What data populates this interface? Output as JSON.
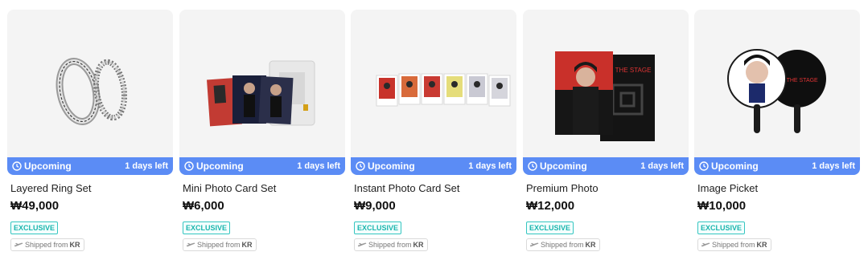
{
  "products": [
    {
      "status": "Upcoming",
      "days_left": "1 days left",
      "name": "Layered Ring Set",
      "price": "₩49,000",
      "badge": "EXCLUSIVE",
      "ship_prefix": "Shipped from",
      "ship_country": "KR"
    },
    {
      "status": "Upcoming",
      "days_left": "1 days left",
      "name": "Mini Photo Card Set",
      "price": "₩6,000",
      "badge": "EXCLUSIVE",
      "ship_prefix": "Shipped from",
      "ship_country": "KR"
    },
    {
      "status": "Upcoming",
      "days_left": "1 days left",
      "name": "Instant Photo Card Set",
      "price": "₩9,000",
      "badge": "EXCLUSIVE",
      "ship_prefix": "Shipped from",
      "ship_country": "KR"
    },
    {
      "status": "Upcoming",
      "days_left": "1 days left",
      "name": "Premium Photo",
      "price": "₩12,000",
      "badge": "EXCLUSIVE",
      "ship_prefix": "Shipped from",
      "ship_country": "KR"
    },
    {
      "status": "Upcoming",
      "days_left": "1 days left",
      "name": "Image Picket",
      "price": "₩10,000",
      "badge": "EXCLUSIVE",
      "ship_prefix": "Shipped from",
      "ship_country": "KR"
    }
  ],
  "artwork_text": {
    "stage_title": "ON THE STAGE"
  },
  "colors": {
    "status_bar": "#5b8cf5",
    "badge": "#35c5c0",
    "card_bg": "#f4f4f4"
  }
}
